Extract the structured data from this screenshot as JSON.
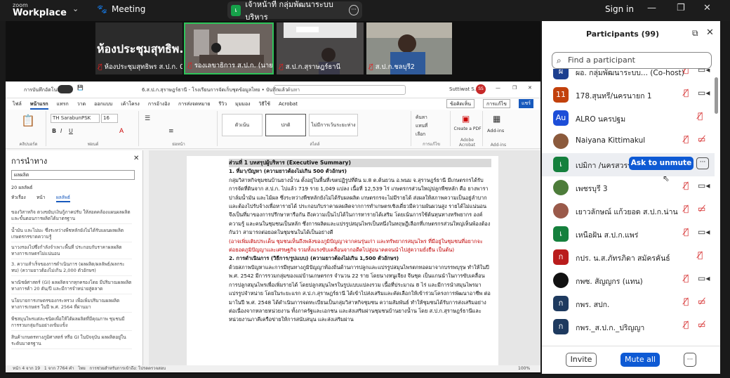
{
  "app": {
    "logo_line1": "zoom",
    "logo_line2": "Workplace",
    "chevron": "⌄",
    "meeting_label": "Meeting",
    "signin": "Sign in"
  },
  "top_pill": {
    "avatar": "เ",
    "name": "เจ้าหน้าที่ กลุ่มพัฒนาระบบบริหาร",
    "more": "···"
  },
  "tiles": [
    {
      "big": "ห้องประชุมสุทธิพ...",
      "name": "ห้องประชุมสุทธิพร ส.ป.ก. 02"
    },
    {
      "name": "รองเลขาธิการ ส.ป.ก. (นายสุรช"
    },
    {
      "name": "ส.ป.ก.สุราษฎร์ธานี"
    },
    {
      "name": "ส.ป.ก.ชลบุรี2"
    }
  ],
  "word": {
    "autosave": "การบันทึกอัตโนมัติ",
    "doc_title": "6.ส.ป.ก.สุราษฎร์ธานี - โรงเรียนการจัดเก็บชุดข้อมูลไทย • บันทึกแล้ว",
    "search": "ค้นหา",
    "user": "Suttiwat S.",
    "menus": [
      "ไฟล์",
      "หน้าแรก",
      "แทรก",
      "วาด",
      "ออกแบบ",
      "เค้าโครง",
      "การอ้างอิง",
      "การส่งจดหมาย",
      "รีวิว",
      "มุมมอง",
      "วิธีใช้",
      "Acrobat"
    ],
    "active_menu": "หน้าแรก",
    "comments_btn": "ข้อคิดเห็น",
    "edit_btn": "การแก้ไข",
    "share_btn": "แชร์",
    "font_name": "TH SarabunPSK",
    "font_size": "16",
    "styles": [
      "ตัวเน้น",
      "ปกติ",
      "ไม่มีการเว้นระยะห่าง"
    ],
    "ribbon_labels": [
      "คลิปบอร์ด",
      "ฟอนต์",
      "ย่อหน้า",
      "สไตล์",
      "การแก้ไข",
      "Adobe Acrobat",
      "Add-ins"
    ],
    "edit_tools": [
      "ค้นหา",
      "แทนที่",
      "เลือก"
    ],
    "acrobat_btn": "Create a PDF",
    "addins_btn": "Add-ins",
    "nav": {
      "title": "การนำทาง",
      "search": "ผลผลิต",
      "count": "20 ผลลัพธ์",
      "tabs": [
        "หัวเรื่อง",
        "หน้า",
        "ผลลัพธ์"
      ],
      "items": [
        "ของวิสาหกิจ ตวงขยับ/เงินกู้ภาคปรับ ให้สอดคล้องแผนผลผลิต และขั้นตอนการผลิตได้มาตรฐาน",
        "น้ำมัน และไม่มะ ซึ่งระหว่างพืชหลักยังไม่ได้รับแผนผลผลิต เกษตรกรขาดความรู้",
        "นาวงรองไปซึ่งกำลังจำเพาะพื้นที่ ประกอบกับราคาผลผลิตทางการเกษตรไม่แน่นอน",
        "3. ความสำเร็จของการดำเนินการ (ผลผลิต/ผลลัพธ์/ผลกระทบ) (ความยาวต้องไม่เกิน 2,000 ตัวอักษร)",
        "พาณิชย์ศาสตร์ (GI) ผลผลิตจากทุกครองโดย มีปริมาณผลผลิตทางการค้า 20 ตัน/ปี และมีการจำหน่ายสู่ตลาด",
        "นโยบายการเกษตรของกระทรวง เพื่อเพิ่มปริมาณผลผลิตทางการเกษตร ในปี พ.ศ. 2564 ที่ผ่านมา",
        "พืชสมุนไพรแต่ละชนิดเพื่อให้ได้ผลผลิตที่มีคุณภาพ ชุมชนมีการรวมกลุ่มกันอย่างเข้มแข็ง",
        "สินค้าเกษตรทางภูมิศาสตร์ หรือ GI ในปัจจุบัน ผลผลิตอยู่ในระดับมาตรฐาน"
      ]
    },
    "page": {
      "heading": "ส่วนที่ 1 บทสรุปผู้บริหาร (Executive Summary)",
      "s1_title": "1. ที่มา/ปัญหา  (ความยาวต้องไม่เกิน 500 ตัวอักษร)",
      "s1_body": "กลุ่มวิสาหกิจชุมชนบ้านยางน้ำน ตั้งอยู่ในพื้นที่เขตปฏิรูปที่ดิน ม.8 ต.ต้นยวน อ.พนม จ.สุราษฎร์ธานี มีเกษตรกรได้รับการจัดที่ดินจาก ส.ป.ก. ไปแล้ว 719 ราย 1,049 แปลง เนื้อที่ 12,539 ไร่ เกษตรกรส่วนใหญ่ปลูกพืชหลัก คือ ยางพารา ปาล์มน้ำมัน และไม้ผล ซึ่งระหว่างพืชหลักยังไม่ได้รับผลผลิต เกษตรกรจะไม่มีรายได้ ส่งผลให้สภาพความเป็นอยู่ลำบากและต้องไปรับจ้างเพื่อหารายได้ ประกอบกับราคาผลผลิตจากการทำเกษตรเชิงเดี่ยวมีความผันผวนสูง รายได้ไม่แน่นอน จึงเป็นที่มาของการปรึกษาหารือกัน ถึงความเป็นไปได้ในการหารายได้เสริม โดยเน้นการใช้ต้นทุนทางทรัพยากร องค์ความรู้ และคนในชุมชนเป็นหลัก ซึ่งการผลิตและแปรรูปสมุนไพรเป็นหนึ่งในทฤษฎีเลือกที่เกษตรกรส่วนใหญ่เห็นพ้องต้องกันว่า สามารถต่อยอดในชุมชนในได้เป็นอย่างดี",
      "s1_red": "(อาจเพิ่มเติมประเด็น ชุมชนเห็นถึงพลังของภูมิปัญญาจากคนรุ่นเก่า และทรัพยากรสมุนไพร ที่มีอยู่ในชุมชนที่อยากจะต่อยอดภูมิปัญญาและเศรษฐกิจ รวมทั้งแรงขับเคลื่อนจากอดีตไปสู่อนาคตจนนำไปสู่ความยั่งยืน เป็นต้น)",
      "s2_title": "2. การดำเนินการ (วิธีการ/รูปแบบ) (ความยาวต้องไม่เกิน 1,500 ตัวอักษร)",
      "s2_body": "ด้วยสภาพปัญหาและการมีทุนทางภูมิปัญญาท้องถิ่นด้านการปลูกและแปรรูปสมุนไพรตกทอดมาจากบรรพบุรุษ ทำให้ในปี พ.ศ. 2542 มีการรวมกลุ่มของแม่บ้านเกษตรกร จำนวน 22 ราย โดยนางหนูเจียง จีนชุด เป็นแกนนำในการขับเคลื่อนการปลูกสมุนไพรเพื่อเพิ่มรายได้ โดยปลูกสมุนไพรในรูปแบบแปลงรวม เนื้อที่ประมาณ 8 ไร่ และมีการนำสมุนไพรมาแปรรูปจำหน่าย โดยในระยะแรก ส.ป.ก.สุราษฎร์ธานี ได้เข้าไปส่งเสริมและคัดเลือกให้เข้าร่วมโครงการพัฒนาอาชีพ ต่อมาในปี พ.ศ. 2548 ได้ดำเนินการจดทะเบียนเป็นกลุ่มวิสาหกิจชุมชน ความสัมพันธ์ ทำให้ชุมชนได้รับการส่งเสริมอย่างต่อเนื่องจากหลายหน่วยงาน ทั้งภาครัฐและเอกชน และส่งเสริมผ่านชุมชนบ้านยางน้ำน โดย ส.ป.ก.สุราษฎร์ธานีและหน่วยงานภาคีเครือข่ายให้การสนับสนุน และส่งเสริมผ่าน"
    },
    "status": {
      "page": "หน้า 4 จาก 19",
      "words": "1 จาก 7764 คำ",
      "lang": "ไทย",
      "access": "การช่วยสำหรับการเข้าถึง: โปรดตรวจสอบ",
      "zoom": "100%"
    }
  },
  "participants": {
    "title": "Participants (99)",
    "search_placeholder": "Find a participant",
    "rows": [
      {
        "initial": "ผ",
        "name": "ผอ. กลุ่มพัฒนาระบบ... (Co-host)",
        "color": "#1c3f8f",
        "mic": "muted",
        "cam": "on"
      },
      {
        "initial": "11",
        "name": "178.สุนทรี/นครนายก 1",
        "color": "#c2410c",
        "mic": "muted",
        "cam": "on"
      },
      {
        "initial": "Au",
        "name": "ALRO นครปฐม",
        "color": "#1d4ed8",
        "mic": "muted",
        "cam": "none"
      },
      {
        "initial": "",
        "name": "Naiyana Kittimakul",
        "color": "#8b5a3c",
        "mic": "muted",
        "cam": "off"
      },
      {
        "initial": "เ",
        "name": "เปมิกา /นครสวรร...",
        "color": "#15803d",
        "mic": "",
        "cam": "",
        "highlight": true
      },
      {
        "initial": "",
        "name": "เพชรบุรี 3",
        "color": "#4d7c3a",
        "mic": "muted",
        "cam": "on"
      },
      {
        "initial": "",
        "name": "เยาวลักษณ์ แก้วยอด ส.ป.ก.น่าน",
        "color": "#9a5a4a",
        "mic": "muted",
        "cam": "off"
      },
      {
        "initial": "เ",
        "name": "เหนือฝัน ส.ป.ก.แพร่",
        "color": "#15803d",
        "mic": "muted",
        "cam": "on"
      },
      {
        "initial": "ก",
        "name": "กปร. น.ส.ภัทรภิดา สมัครคันธ์",
        "color": "#b91c1c",
        "mic": "muted",
        "cam": "none"
      },
      {
        "initial": "",
        "name": "กพซ. สัญญกร (แทน)",
        "color": "#111111",
        "mic": "muted",
        "cam": "on"
      },
      {
        "initial": "ก",
        "name": "กพร. สปก.",
        "color": "#1e3a5f",
        "mic": "muted",
        "cam": "off"
      },
      {
        "initial": "ก",
        "name": "กพร._ส.ป.ก._ปริญญา",
        "color": "#1e3a5f",
        "mic": "muted",
        "cam": "off"
      }
    ],
    "ask_unmute": "Ask to unmute",
    "invite": "Invite",
    "mute_all": "Mute all",
    "more": "···"
  }
}
